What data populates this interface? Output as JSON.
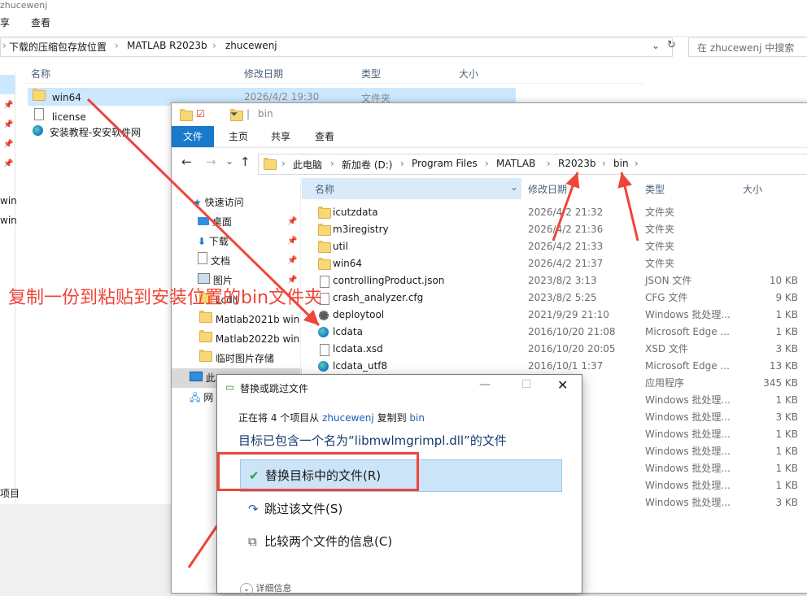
{
  "back_window": {
    "title": "zhucewenj",
    "tab_share": "享",
    "tab_view": "查看",
    "breadcrumb": [
      "下载的压缩包存放位置",
      "MATLAB R2023b",
      "zhucewenj"
    ],
    "search_placeholder": "在 zhucewenj 中搜索",
    "columns": {
      "name": "名称",
      "date": "修改日期",
      "type": "类型",
      "size": "大小"
    },
    "files": [
      {
        "name": "win64",
        "date": "2026/4/2 19:30",
        "type": "文件夹",
        "icon": "folder-icon"
      },
      {
        "name": "license",
        "date": "",
        "type": "",
        "icon": "file-icon"
      },
      {
        "name": "安装教程-安安软件网",
        "date": "",
        "type": "",
        "icon": "edge-icon"
      }
    ],
    "left_labels": [
      "win",
      "win"
    ],
    "status_tail": "项目"
  },
  "front_window": {
    "title": "bin",
    "tabs": [
      "文件",
      "主页",
      "共享",
      "查看"
    ],
    "breadcrumb": [
      "此电脑",
      "新加卷 (D:)",
      "Program Files",
      "MATLAB",
      "R2023b",
      "bin"
    ],
    "columns": {
      "name": "名称",
      "date": "修改日期",
      "type": "类型",
      "size": "大小"
    },
    "nav": [
      {
        "label": "快速访问",
        "icon": "star-icon",
        "pinned": false
      },
      {
        "label": "桌面",
        "icon": "desktop-icon",
        "pinned": true
      },
      {
        "label": "下载",
        "icon": "download-icon",
        "pinned": true
      },
      {
        "label": "文档",
        "icon": "document-icon",
        "pinned": true
      },
      {
        "label": "图片",
        "icon": "picture-icon",
        "pinned": true
      },
      {
        "label": "Lcdll",
        "icon": "folder-icon",
        "pinned": false
      },
      {
        "label": "Matlab2021b win",
        "icon": "folder-icon",
        "pinned": false
      },
      {
        "label": "Matlab2022b win",
        "icon": "folder-icon",
        "pinned": false
      },
      {
        "label": "临时图片存储",
        "icon": "folder-icon",
        "pinned": false
      },
      {
        "label": "此",
        "icon": "computer-icon",
        "pinned": false
      },
      {
        "label": "网",
        "icon": "network-icon",
        "pinned": false
      }
    ],
    "files": [
      {
        "name": "icutzdata",
        "date": "2026/4/2 21:32",
        "type": "文件夹",
        "size": "",
        "icon": "folder-icon"
      },
      {
        "name": "m3iregistry",
        "date": "2026/4/2 21:36",
        "type": "文件夹",
        "size": "",
        "icon": "folder-icon"
      },
      {
        "name": "util",
        "date": "2026/4/2 21:33",
        "type": "文件夹",
        "size": "",
        "icon": "folder-icon"
      },
      {
        "name": "win64",
        "date": "2026/4/2 21:37",
        "type": "文件夹",
        "size": "",
        "icon": "folder-icon"
      },
      {
        "name": "controllingProduct.json",
        "date": "2023/8/2 3:13",
        "type": "JSON 文件",
        "size": "10 KB",
        "icon": "file-icon"
      },
      {
        "name": "crash_analyzer.cfg",
        "date": "2023/8/2 5:25",
        "type": "CFG 文件",
        "size": "9 KB",
        "icon": "file-icon"
      },
      {
        "name": "deploytool",
        "date": "2021/9/29 21:10",
        "type": "Windows 批处理...",
        "size": "1 KB",
        "icon": "gear-icon"
      },
      {
        "name": "lcdata",
        "date": "2016/10/20 21:08",
        "type": "Microsoft Edge ...",
        "size": "1 KB",
        "icon": "edge-icon"
      },
      {
        "name": "lcdata.xsd",
        "date": "2016/10/20 20:05",
        "type": "XSD 文件",
        "size": "3 KB",
        "icon": "file-icon"
      },
      {
        "name": "lcdata_utf8",
        "date": "2016/10/1 1:37",
        "type": "Microsoft Edge ...",
        "size": "13 KB",
        "icon": "edge-icon"
      },
      {
        "name": "",
        "date": "5:20",
        "type": "应用程序",
        "size": "345 KB",
        "icon": ""
      },
      {
        "name": "",
        "date": "21:41",
        "type": "Windows 批处理...",
        "size": "1 KB",
        "icon": ""
      },
      {
        "name": "",
        "date": "2:47",
        "type": "Windows 批处理...",
        "size": "3 KB",
        "icon": ""
      },
      {
        "name": "",
        "date": "0:11",
        "type": "Windows 批处理...",
        "size": "1 KB",
        "icon": ""
      },
      {
        "name": "",
        "date": "5:26",
        "type": "Windows 批处理...",
        "size": "1 KB",
        "icon": ""
      },
      {
        "name": "",
        "date": ":31",
        "type": "Windows 批处理...",
        "size": "1 KB",
        "icon": ""
      },
      {
        "name": "",
        "date": "20:44",
        "type": "Windows 批处理...",
        "size": "1 KB",
        "icon": ""
      },
      {
        "name": "",
        "date": "20:10",
        "type": "Windows 批处理...",
        "size": "3 KB",
        "icon": ""
      }
    ]
  },
  "dialog": {
    "title": "替换或跳过文件",
    "copy_prefix": "正在将 4 个项目从",
    "copy_from": "zhucewenj",
    "copy_mid": "复制到",
    "copy_to": "bin",
    "message": "目标已包含一个名为“libmwlmgrimpl.dll”的文件",
    "options": [
      {
        "label": "替换目标中的文件(R)",
        "icon": "check-icon"
      },
      {
        "label": "跳过该文件(S)",
        "icon": "skip-icon"
      },
      {
        "label": "比较两个文件的信息(C)",
        "icon": "compare-icon"
      }
    ],
    "details": "详细信息"
  },
  "annotation": {
    "text": "复制一份到粘贴到安装位置的bin文件夹",
    "color": "#f0443a"
  }
}
